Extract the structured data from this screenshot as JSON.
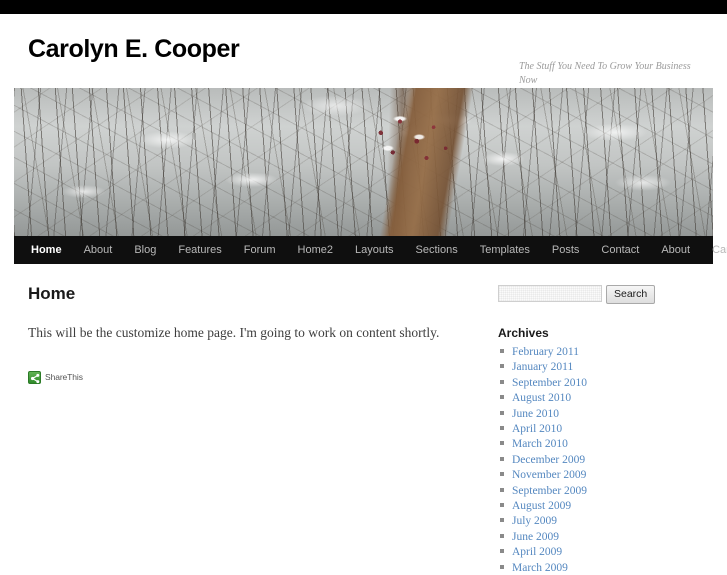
{
  "site": {
    "title": "Carolyn E. Cooper",
    "description": "The Stuff You Need To Grow Your Business Now"
  },
  "nav": {
    "items": [
      {
        "label": "Home",
        "active": true
      },
      {
        "label": "About",
        "active": false
      },
      {
        "label": "Blog",
        "active": false
      },
      {
        "label": "Features",
        "active": false
      },
      {
        "label": "Forum",
        "active": false
      },
      {
        "label": "Home2",
        "active": false
      },
      {
        "label": "Layouts",
        "active": false
      },
      {
        "label": "Sections",
        "active": false
      },
      {
        "label": "Templates",
        "active": false
      },
      {
        "label": "Posts",
        "active": false
      },
      {
        "label": "Contact",
        "active": false
      },
      {
        "label": "About",
        "active": false
      },
      {
        "label": "Carousel Page Template",
        "active": false
      }
    ]
  },
  "content": {
    "page_title": "Home",
    "paragraph": "This will be the customize home page. I'm going to work on content shortly.",
    "share": {
      "icon": "share-icon",
      "label": "ShareThis",
      "color": "#3f9c35"
    }
  },
  "sidebar": {
    "search": {
      "value": "",
      "placeholder": "",
      "button_label": "Search"
    },
    "archives": {
      "title": "Archives",
      "items": [
        "February 2011",
        "January 2011",
        "September 2010",
        "August 2010",
        "June 2010",
        "April 2010",
        "March 2010",
        "December 2009",
        "November 2009",
        "September 2009",
        "August 2009",
        "July 2009",
        "June 2009",
        "April 2009",
        "March 2009"
      ]
    }
  },
  "theme": {
    "link_color": "#5588c0",
    "nav_background": "#0f0f0f",
    "topbar_background": "#000000",
    "text_color": "#333333"
  }
}
